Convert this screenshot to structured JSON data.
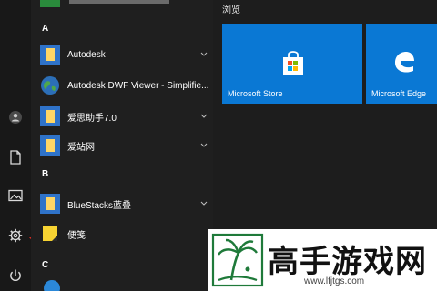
{
  "rail": {
    "user_icon": "user-icon",
    "documents_icon": "document-icon",
    "pictures_icon": "picture-icon",
    "settings_icon": "gear-icon",
    "power_icon": "power-icon",
    "pointer_color": "#d42a22"
  },
  "applist": {
    "top_partial": "",
    "groups": [
      {
        "letter": "A"
      },
      {
        "letter": "B"
      },
      {
        "letter": "C"
      }
    ],
    "items": [
      {
        "label": "Autodesk",
        "icon": "folder-icon",
        "has_chevron": true
      },
      {
        "label": "Autodesk DWF Viewer - Simplifie...",
        "icon": "globe-icon",
        "has_chevron": false
      },
      {
        "label": "爱思助手7.0",
        "icon": "folder-icon",
        "has_chevron": true
      },
      {
        "label": "爱站网",
        "icon": "folder-icon",
        "has_chevron": true
      },
      {
        "label": "BlueStacks蓝叠",
        "icon": "folder-icon",
        "has_chevron": true
      },
      {
        "label": "便笺",
        "icon": "sticky-note-icon",
        "has_chevron": false
      }
    ]
  },
  "tiles": {
    "group_title": "浏览",
    "items": [
      {
        "label": "Microsoft Store",
        "icon": "store-bag-icon"
      },
      {
        "label": "Microsoft Edge",
        "icon": "edge-icon"
      }
    ],
    "color": "#0a78d4"
  },
  "watermark": {
    "title": "高手游戏网",
    "url": "www.lfjtgs.com",
    "logo": "palm-tree-logo"
  }
}
